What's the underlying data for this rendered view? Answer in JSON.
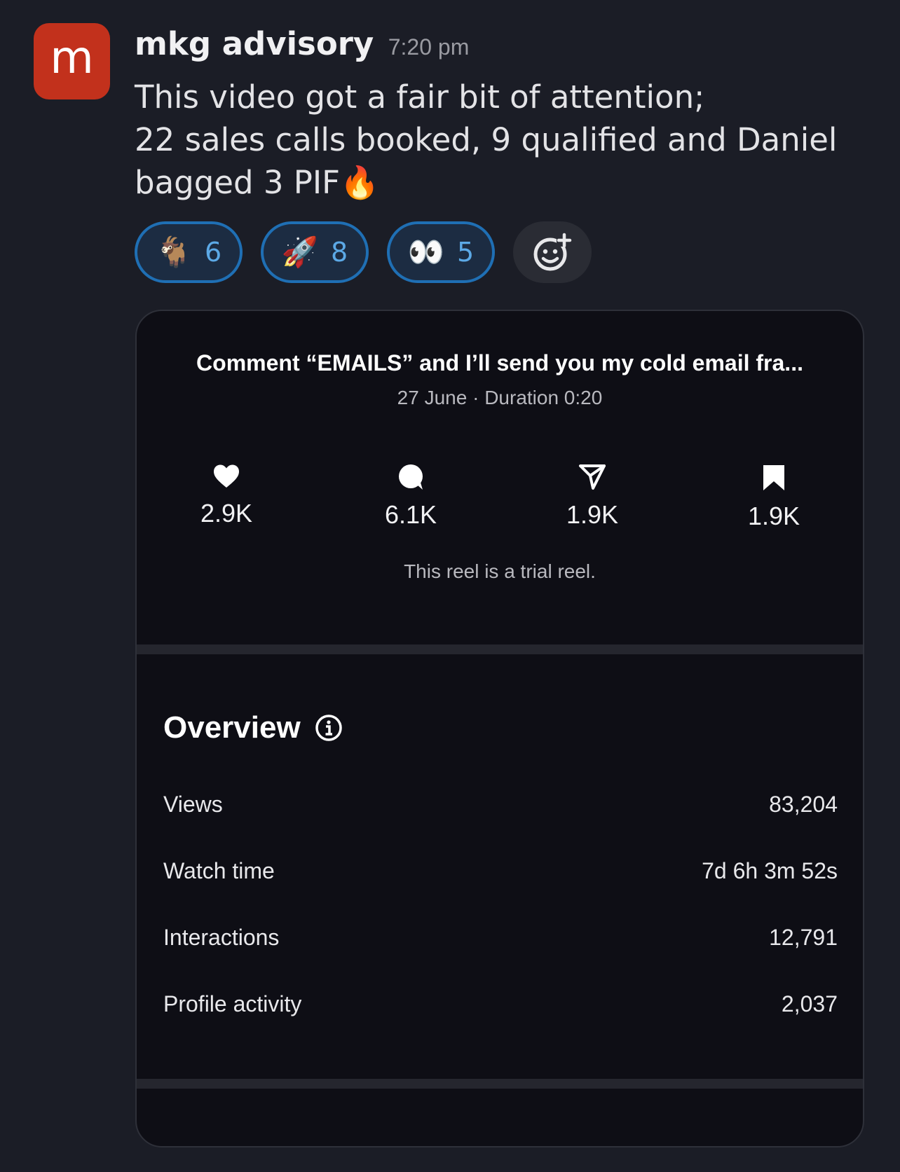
{
  "message": {
    "avatar_letter": "m",
    "sender": "mkg advisory",
    "time": "7:20 pm",
    "lines": [
      "This video got a fair bit of attention;",
      "22 sales calls booked, 9 qualified and Daniel",
      "bagged 3 PIF🔥"
    ]
  },
  "reactions": [
    {
      "icon": "goat-icon",
      "emoji": "🐐",
      "count": "6"
    },
    {
      "icon": "rocket-icon",
      "emoji": "🚀",
      "count": "8"
    },
    {
      "icon": "eyes-icon",
      "emoji": "👀",
      "count": "5"
    }
  ],
  "reel": {
    "title": "Comment “EMAILS” and I’ll send you my cold email fra...",
    "meta": "27 June · Duration 0:20",
    "stats": {
      "likes": "2.9K",
      "comments": "6.1K",
      "shares": "1.9K",
      "saves": "1.9K"
    },
    "trial_note": "This reel is a trial reel."
  },
  "overview": {
    "title": "Overview",
    "metrics": [
      {
        "label": "Views",
        "value": "83,204"
      },
      {
        "label": "Watch time",
        "value": "7d 6h 3m 52s"
      },
      {
        "label": "Interactions",
        "value": "12,791"
      },
      {
        "label": "Profile activity",
        "value": "2,037"
      }
    ]
  },
  "colors": {
    "background": "#1b1d26",
    "avatar": "#c2311c",
    "reaction_border": "#1f6fb4",
    "reaction_count": "#5ca9e6",
    "card_background": "#0e0e15"
  }
}
